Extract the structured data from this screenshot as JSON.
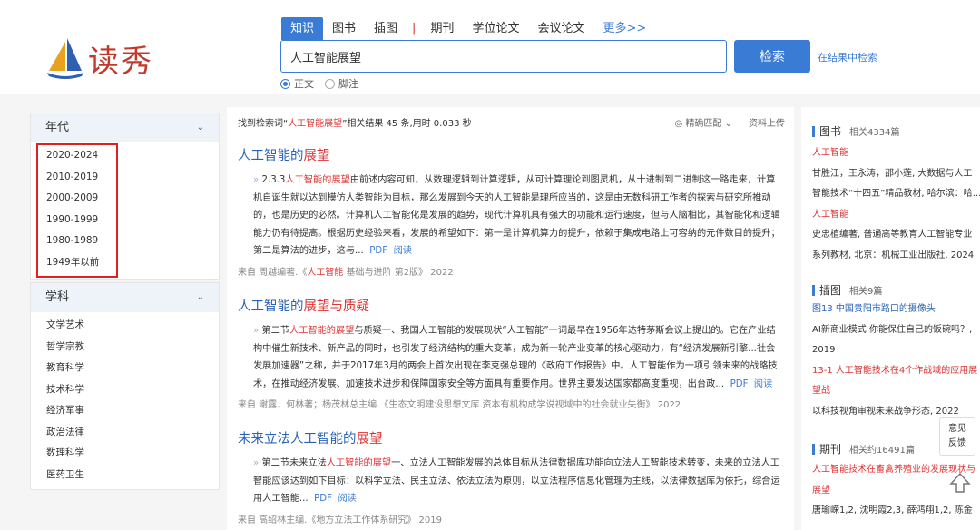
{
  "logo": {
    "text": "读秀"
  },
  "tabs": [
    "知识",
    "图书",
    "插图",
    "期刊",
    "学位论文",
    "会议论文",
    "更多>>"
  ],
  "search": {
    "value": "人工智能展望",
    "button": "检索",
    "search_in_results": "在结果中检索"
  },
  "radios": [
    {
      "label": "正文",
      "checked": true
    },
    {
      "label": "脚注",
      "checked": false
    }
  ],
  "facets": {
    "year": {
      "title": "年代",
      "items": [
        "2020-2024",
        "2010-2019",
        "2000-2009",
        "1990-1999",
        "1980-1989",
        "1949年以前"
      ]
    },
    "subject": {
      "title": "学科",
      "items": [
        "文学艺术",
        "哲学宗教",
        "教育科学",
        "技术科学",
        "经济军事",
        "政治法律",
        "数理科学",
        "医药卫生"
      ]
    }
  },
  "stats": {
    "prefix": "找到检索词“",
    "keyword": "人工智能展望",
    "suffix": "”相关结果 45 条,用时 0.033 秒"
  },
  "tools": {
    "precise": "精确匹配",
    "upload": "资料上传"
  },
  "results": [
    {
      "title_pre": "人工智能",
      "title_mid": "的",
      "title_hl": "展望",
      "title_post": "",
      "body_lead": "2.3.3",
      "body_hl": "人工智能的展望",
      "body_rest": "由前述内容可知，从数理逻辑到计算逻辑，从可计算理论到图灵机，从十进制到二进制这一路走来，计算机自诞生就以达到模仿人类智能为目标，那么发展到今天的人工智能是理所应当的，这是由无数科研工作者的探索与研究所推动的，也是历史的必然。计算机人工智能化是发展的趋势，现代计算机具有强大的功能和运行速度，但与人脑相比，其智能化和逻辑能力仍有待提高。根据历史经验来看，发展的希望如下：第一是计算机算力的提升，依赖于集成电路上可容纳的元件数目的提升；第二是算法的进步，这与...",
      "pdf": "PDF",
      "read": "阅读",
      "src_pre": "来自 周越编著.《",
      "src_hl": "人工智能",
      "src_post": " 基础与进阶 第2版》 2022"
    },
    {
      "title_pre": "人工智能",
      "title_mid": "的",
      "title_hl": "展望",
      "title_post": "与质疑",
      "body_lead": "第二节",
      "body_hl": "人工智能的展望",
      "body_rest": "与质疑一、我国人工智能的发展现状“人工智能”一词最早在1956年达特茅斯会议上提出的。它在产业结构中催生新技术、新产品的同时，也引发了经济结构的重大变革，成为新一轮产业变革的核心驱动力，有“经济发展新引擎...社会发展加速器”之称，并于2017年3月的两会上首次出现在李克强总理的《政府工作报告》中。人工智能作为一项引领未来的战略技术，在推动经济发展、加速技术进步和保障国家安全等方面具有重要作用。世界主要发达国家都高度重视，出台政...",
      "pdf": "PDF",
      "read": "阅读",
      "src_pre": "来自 谢露，何林著；杨茂林总主编.《生态文明建设思想文库 资本有机构成学说视域中的社会就业失衡》 2022",
      "src_hl": "",
      "src_post": ""
    },
    {
      "title_pre": "未来立法人工智能",
      "title_mid": "的",
      "title_hl": "展望",
      "title_post": "",
      "body_lead": "第二节未来立法",
      "body_hl": "人工智能的展望",
      "body_rest": "一、立法人工智能发展的总体目标从法律数据库功能向立法人工智能技术转变，未来的立法人工智能应该达到如下目标：以科学立法、民主立法、依法立法为原则，以立法程序信息化管理为主线，以法律数据库为依托，综合运用人工智能...",
      "pdf": "PDF",
      "read": "阅读",
      "src_pre": "来自 高绍林主编.《地方立法工作体系研究》 2019",
      "src_hl": "",
      "src_post": ""
    }
  ],
  "right": {
    "books": {
      "title": "图书",
      "count": "相关4334篇",
      "lines": [
        "人工智能",
        "甘胜江，王永涛，邵小莲, 大数据与人工",
        "智能技术“十四五”精品教材, 哈尔滨：哈...",
        "人工智能",
        "史忠植编著, 普通高等教育人工智能专业",
        "系列教材, 北京：机械工业出版社, 2024"
      ]
    },
    "illus": {
      "title": "插图",
      "count": "相关9篇",
      "lines": [
        "图13 中国贵阳市路口的摄像头",
        "AI新商业模式 你能保住自己的饭碗吗？,",
        "2019",
        "13-1 人工智能技术在4个作战域的应用展",
        "望战",
        "以科技视角审视未来战争形态, 2022"
      ]
    },
    "journals": {
      "title": "期刊",
      "count": "相关约16491篇",
      "lines": [
        "人工智能技术在畜禽养殖业的发展现状与",
        "展望",
        "唐瑜嵘1,2, 沈明霞2,3, 薛鸿翔1,2, 陈金"
      ]
    }
  },
  "feedback": "意见反馈"
}
